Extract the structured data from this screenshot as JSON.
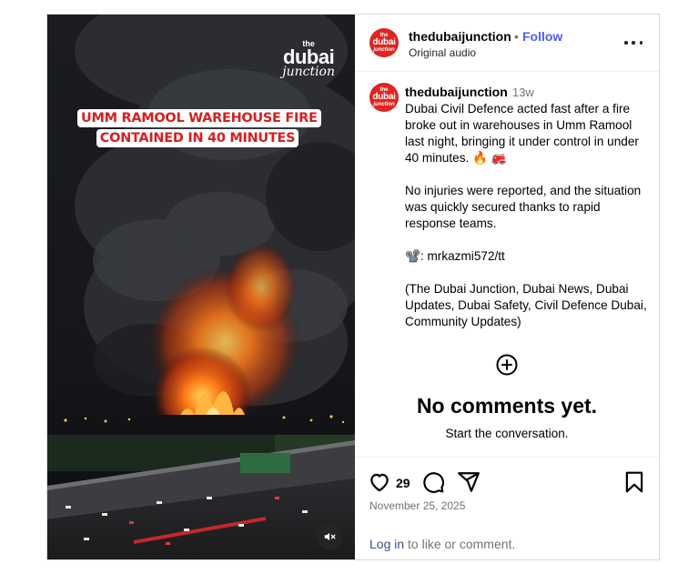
{
  "media": {
    "watermark_top": "the",
    "watermark_main": "dubai",
    "watermark_bottom": "junction",
    "headline": "UMM RAMOOL WAREHOUSE FIRE CONTAINED IN 40 MINUTES",
    "mute_icon": "speaker-muted-icon"
  },
  "header": {
    "username": "thedubaijunction",
    "separator": "•",
    "follow_label": "Follow",
    "audio": "Original audio",
    "avatar_top": "the",
    "avatar_main": "dubai",
    "avatar_bottom": "junction"
  },
  "caption": {
    "username": "thedubaijunction",
    "time": "13w",
    "paragraphs": [
      "Dubai Civil Defence acted fast after a fire broke out in warehouses in Umm Ramool last night, bringing it under control in under 40 minutes. 🔥 🚒",
      "No injuries were reported, and the situation was quickly secured thanks to rapid response teams.",
      "📽️: mrkazmi572/tt",
      "(The Dubai Junction, Dubai News, Dubai Updates, Dubai Safety, Civil Defence Dubai, Community Updates)"
    ]
  },
  "comments": {
    "title": "No comments yet.",
    "subtitle": "Start the conversation."
  },
  "actions": {
    "like_count": "29",
    "date": "November 25, 2025",
    "login_link": "Log in",
    "login_rest": " to like or comment."
  },
  "colors": {
    "brand_red": "#e0241f",
    "follow_blue": "#4a5df9",
    "headline_red": "#d81f1f"
  }
}
